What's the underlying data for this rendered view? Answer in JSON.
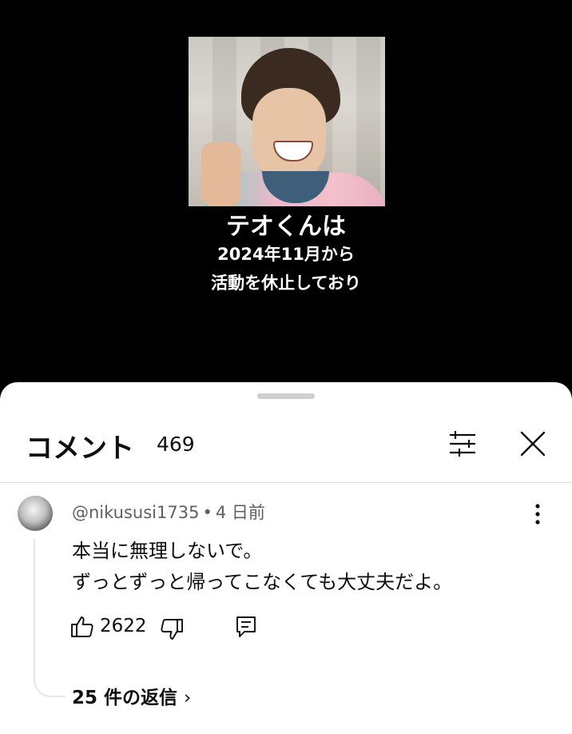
{
  "video": {
    "caption_line1": "テオくんは",
    "caption_line2": "2024年11月から",
    "caption_line3": "活動を休止しており"
  },
  "comments_panel": {
    "title": "コメント",
    "count": "469",
    "filter_icon": "sort-filter-icon",
    "close_icon": "close-icon"
  },
  "comment": {
    "author": "@nikususi1735",
    "separator": "•",
    "time": "4 日前",
    "text_line1": "本当に無理しないで。",
    "text_line2": "ずっとずっと帰ってこなくても大丈夫だよ。",
    "likes": "2622",
    "replies_label": "25 件の返信",
    "replies_chevron": "›"
  },
  "colors": {
    "background_top": "#000000",
    "sheet": "#ffffff",
    "text_primary": "#0f0f0f",
    "text_secondary": "#606060"
  }
}
